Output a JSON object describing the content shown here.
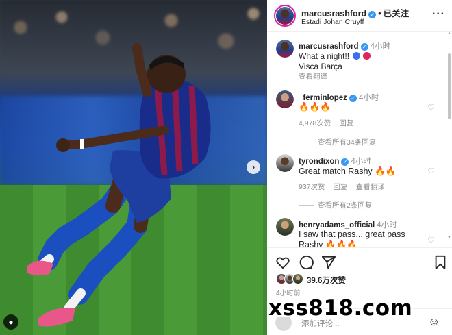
{
  "post": {
    "username": "marcusrashford",
    "follow_status": "已关注",
    "location": "Estadi Johan Cruyff",
    "more_icon": "more-options-icon"
  },
  "caption": {
    "username": "marcusrashford",
    "time": "4小时",
    "line1": "What a night!!",
    "line2": "Visca Barça",
    "translate": "查看翻译"
  },
  "comments": [
    {
      "username": "_ferminlopez",
      "time": "4小时",
      "text": "🔥🔥🔥",
      "likes": "4,978次赞",
      "reply": "回复",
      "view_replies": "查看所有34条回复"
    },
    {
      "username": "tyrondixon",
      "time": "4小时",
      "text": "Great match Rashy",
      "text_emoji": "🔥🔥",
      "likes": "937次赞",
      "reply": "回复",
      "translate": "查看翻译",
      "view_replies": "查看所有2条回复"
    },
    {
      "username": "henryadams_official",
      "time": "4小时",
      "text_line1": "I saw that pass... great pass",
      "text_line2": "Rashy",
      "text_emoji": "🔥🔥🔥"
    }
  ],
  "footer": {
    "likes": "39.6万次赞",
    "time": "4小时前",
    "add_comment_placeholder": "添加评论..."
  },
  "watermark": "xss818.com",
  "colors": {
    "verified": "#3897f0",
    "muted_text": "#8e8e8e",
    "story_ring": "#d6249f"
  }
}
